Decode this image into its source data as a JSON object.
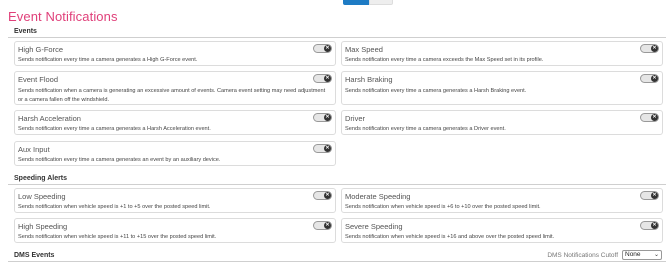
{
  "page_title": "Event Notifications",
  "sections": {
    "events": "Events",
    "speeding": "Speeding Alerts",
    "dms": "DMS Events"
  },
  "events": [
    {
      "name": "High G-Force",
      "desc": "Sends notification every time a camera generates a High G-Force event.",
      "enabled": false
    },
    {
      "name": "Max Speed",
      "desc": "Sends notification every time a camera exceeds the Max Speed set in its profile.",
      "enabled": false
    },
    {
      "name": "Event Flood",
      "desc": "Sends notification when a camera is generating an excessive amount of events. Camera event setting may need adjustment or a camera fallen off the windshield.",
      "enabled": false
    },
    {
      "name": "Harsh Braking",
      "desc": "Sends notification every time a camera generates a Harsh Braking event.",
      "enabled": false
    },
    {
      "name": "Harsh Acceleration",
      "desc": "Sends notification every time a camera generates a Harsh Acceleration event.",
      "enabled": false
    },
    {
      "name": "Driver",
      "desc": "Sends notification every time a camera generates a Driver event.",
      "enabled": false
    },
    {
      "name": "Aux Input",
      "desc": "Sends notification every time a camera generates an event by an auxiliary device.",
      "enabled": false
    }
  ],
  "speeding": [
    {
      "name": "Low Speeding",
      "desc": "Sends notification when vehicle speed is +1 to +5 over the posted speed limit.",
      "enabled": false
    },
    {
      "name": "Moderate Speeding",
      "desc": "Sends notification when vehicle speed is +6 to +10 over the posted speed limit.",
      "enabled": false
    },
    {
      "name": "High Speeding",
      "desc": "Sends notification when vehicle speed is +11 to +15 over the posted speed limit.",
      "enabled": false
    },
    {
      "name": "Severe Speeding",
      "desc": "Sends notification when vehicle speed is +16 and above over the posted speed limit.",
      "enabled": false
    }
  ],
  "toggle_off_glyph": "✕",
  "dms": {
    "cutoff_label": "DMS Notifications Cutoff",
    "cutoff_value": "None"
  },
  "colors": {
    "title": "#e0407a",
    "accent": "#1e7bc4"
  }
}
